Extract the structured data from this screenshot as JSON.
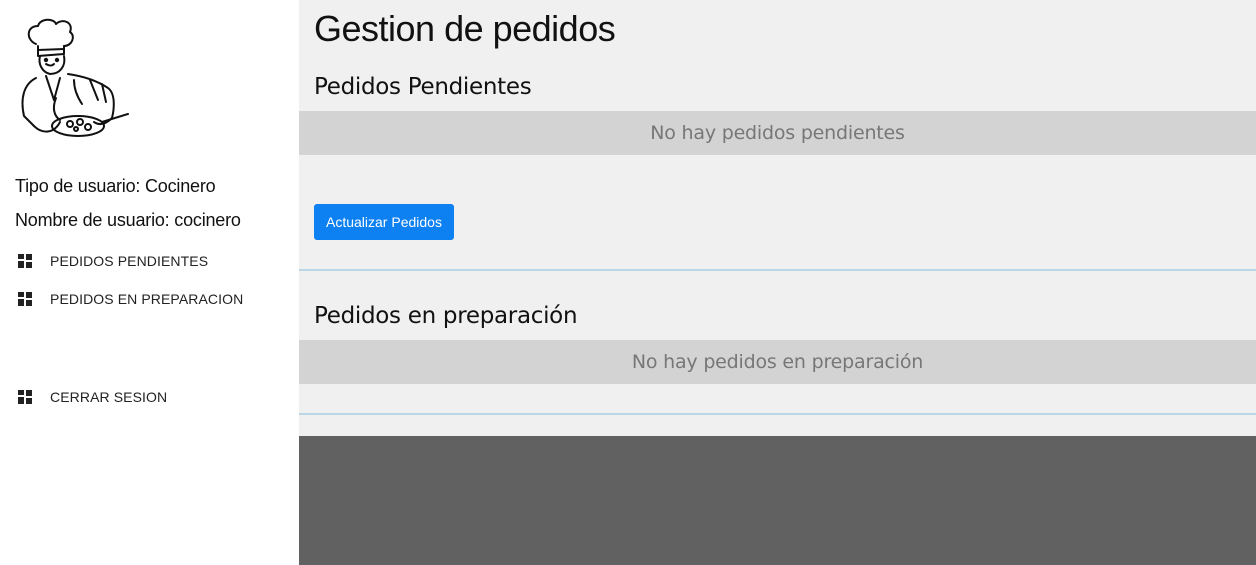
{
  "sidebar": {
    "user_type": "Tipo de usuario: Cocinero",
    "user_name": "Nombre de usuario: cocinero",
    "items": [
      {
        "label": "PEDIDOS PENDIENTES",
        "icon": "dashboard-icon"
      },
      {
        "label": "PEDIDOS EN PREPARACION",
        "icon": "dashboard-icon"
      },
      {
        "label": "CERRAR SESION",
        "icon": "dashboard-icon"
      }
    ]
  },
  "main": {
    "title": "Gestion de pedidos",
    "pending": {
      "title": "Pedidos Pendientes",
      "empty_text": "No hay pedidos pendientes",
      "button_label": "Actualizar Pedidos"
    },
    "preparing": {
      "title": "Pedidos en preparación",
      "empty_text": "No hay pedidos en preparación"
    }
  },
  "colors": {
    "button": "#0d80f2",
    "main_bg": "#f0f0f0",
    "band_bg": "#d3d3d3",
    "footer_bg": "#616161",
    "divider": "#b9d6e6"
  }
}
